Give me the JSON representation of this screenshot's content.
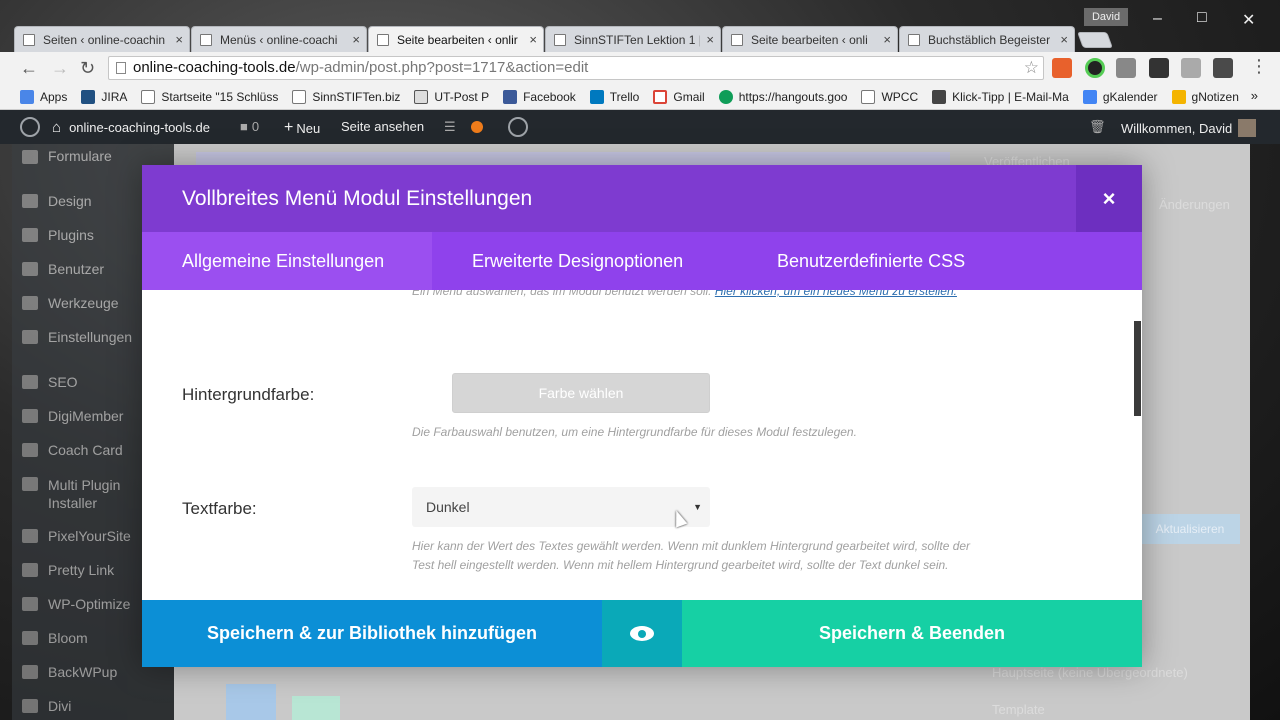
{
  "browser": {
    "tabs": [
      {
        "title": "Seiten ‹ online-coachin",
        "active": false
      },
      {
        "title": "Menüs ‹ online-coachi",
        "active": false
      },
      {
        "title": "Seite bearbeiten ‹ onlir",
        "active": true
      },
      {
        "title": "SinnSTIFTen Lektion 1 |",
        "active": false
      },
      {
        "title": "Seite bearbeiten ‹ onli",
        "active": false
      },
      {
        "title": "Buchstäblich Begeister",
        "active": false
      }
    ],
    "close_glyph": "×",
    "profile_name": "David",
    "url_host": "online-coaching-tools.de",
    "url_path": "/wp-admin/post.php?post=1717&action=edit",
    "bookmarks": [
      {
        "label": "Apps",
        "color": "#4a86e8"
      },
      {
        "label": "JIRA",
        "color": "#205081"
      },
      {
        "label": "Startseite \"15 Schlüss",
        "color": "#ffffff"
      },
      {
        "label": "SinnSTIFTen.biz",
        "color": "#ffffff"
      },
      {
        "label": "UT-Post P",
        "color": "#dddddd"
      },
      {
        "label": "Facebook",
        "color": "#3b5998"
      },
      {
        "label": "Trello",
        "color": "#0079bf"
      },
      {
        "label": "Gmail",
        "color": "#db4437"
      },
      {
        "label": "https://hangouts.goo",
        "color": "#0f9d58"
      },
      {
        "label": "WPCC",
        "color": "#ffffff"
      },
      {
        "label": "Klick-Tipp | E-Mail-Ma",
        "color": "#444444"
      },
      {
        "label": "gKalender",
        "color": "#4285f4"
      },
      {
        "label": "gNotizen",
        "color": "#f4b400"
      }
    ],
    "bookmarks_more": "»"
  },
  "wp_admin_bar": {
    "site": "online-coaching-tools.de",
    "comments": "0",
    "new": "Neu",
    "view": "Seite ansehen",
    "welcome": "Willkommen, David"
  },
  "wp_sidebar": {
    "items": [
      "Formulare",
      "Design",
      "Plugins",
      "Benutzer",
      "Werkzeuge",
      "Einstellungen",
      "SEO",
      "DigiMember",
      "Coach Card",
      "Multi Plugin Installer",
      "PixelYourSite",
      "Pretty Link",
      "WP-Optimize",
      "Bloom",
      "BackWPup",
      "Divi"
    ]
  },
  "wp_background_text": {
    "publish": "Veröffentlichen",
    "changes": "Änderungen",
    "page_parent": "Hauptseite (keine Übergeordnete)",
    "template": "Template",
    "update": "Aktualisieren"
  },
  "modal": {
    "title": "Vollbreites Menü Modul Einstellungen",
    "close": "×",
    "tabs": [
      "Allgemeine Einstellungen",
      "Erweiterte Designoptionen",
      "Benutzerdefinierte CSS"
    ],
    "menu_help_prefix": "Ein Menü auswählen, das im Modul benutzt werden soll.",
    "menu_help_link": "Hier klicken, um ein neues Menü zu erstellen.",
    "bg_label": "Hintergrundfarbe:",
    "bg_button": "Farbe wählen",
    "bg_help": "Die Farbauswahl benutzen, um eine Hintergrundfarbe für dieses Modul festzulegen.",
    "text_label": "Textfarbe:",
    "text_value": "Dunkel",
    "text_help": "Hier kann der Wert des Textes gewählt werden. Wenn mit dunklem Hintergrund gearbeitet wird, sollte der Test hell eingestellt werden. Wenn mit hellem Hintergrund gearbeitet wird, sollte der Text dunkel sein.",
    "save_library": "Speichern & zur Bibliothek hinzufügen",
    "save_exit": "Speichern & Beenden"
  },
  "colors": {
    "modal_header": "#7e3bd0",
    "modal_tabs": "#8f42ec",
    "save_library": "#0c8fd6",
    "preview": "#0aa9b8",
    "save_exit": "#16d0a4"
  }
}
